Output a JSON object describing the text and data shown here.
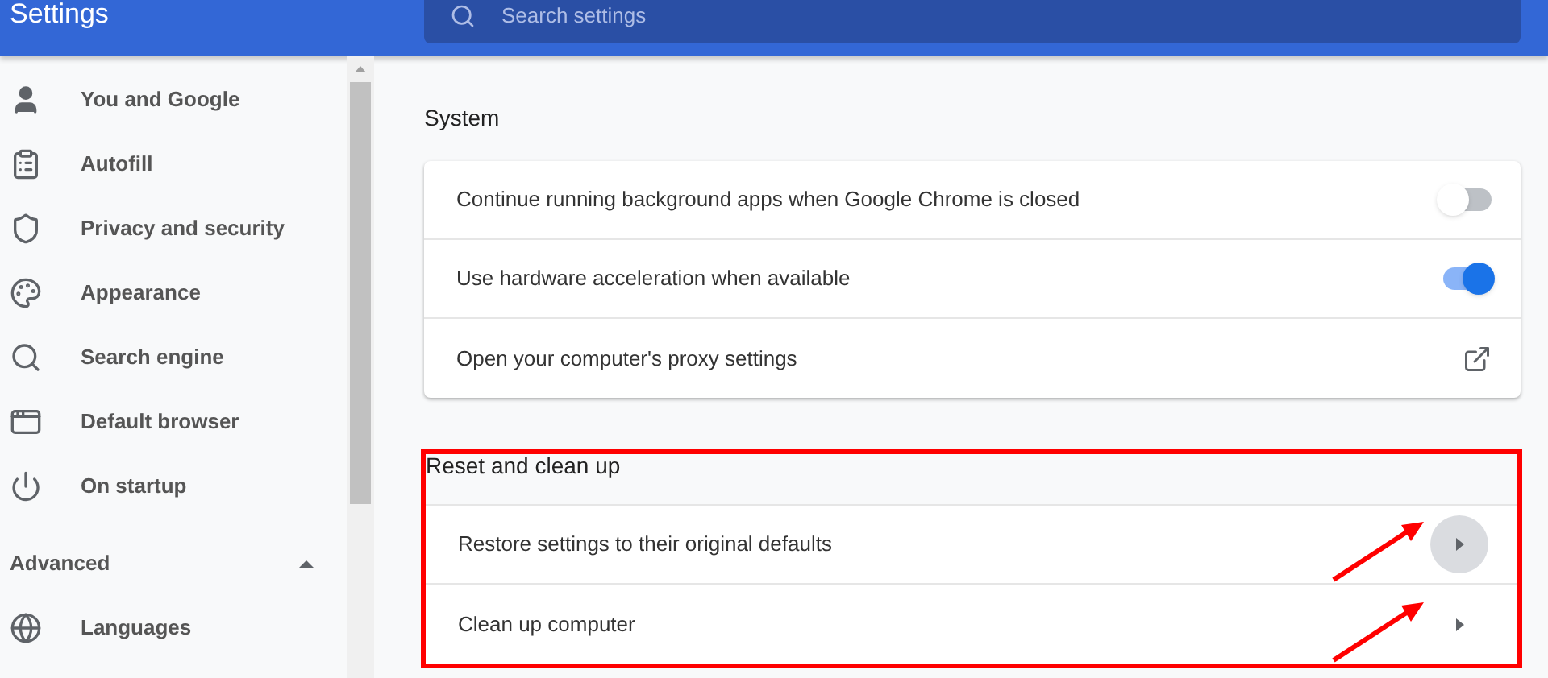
{
  "header": {
    "title": "Settings",
    "search": {
      "placeholder": "Search settings"
    }
  },
  "sidebar": {
    "items": [
      {
        "label": "You and Google",
        "selected": false
      },
      {
        "label": "Autofill",
        "selected": false
      },
      {
        "label": "Privacy and security",
        "selected": false
      },
      {
        "label": "Appearance",
        "selected": false
      },
      {
        "label": "Search engine",
        "selected": false
      },
      {
        "label": "Default browser",
        "selected": false
      },
      {
        "label": "On startup",
        "selected": false
      }
    ],
    "advanced": {
      "label": "Advanced",
      "expanded": true,
      "items": [
        {
          "label": "Languages",
          "selected": false
        }
      ]
    }
  },
  "sections": [
    {
      "title": "System",
      "rows": [
        {
          "label": "Continue running background apps when Google Chrome is closed",
          "kind": "toggle",
          "on": false
        },
        {
          "label": "Use hardware acceleration when available",
          "kind": "toggle",
          "on": true
        },
        {
          "label": "Open your computer's proxy settings",
          "kind": "external"
        }
      ]
    },
    {
      "title": "Reset and clean up",
      "highlighted": true,
      "rows": [
        {
          "label": "Restore settings to their original defaults",
          "kind": "subpage",
          "hovered": true,
          "arrow_pointed": true
        },
        {
          "label": "Clean up computer",
          "kind": "subpage",
          "hovered": false,
          "arrow_pointed": true
        }
      ]
    }
  ]
}
